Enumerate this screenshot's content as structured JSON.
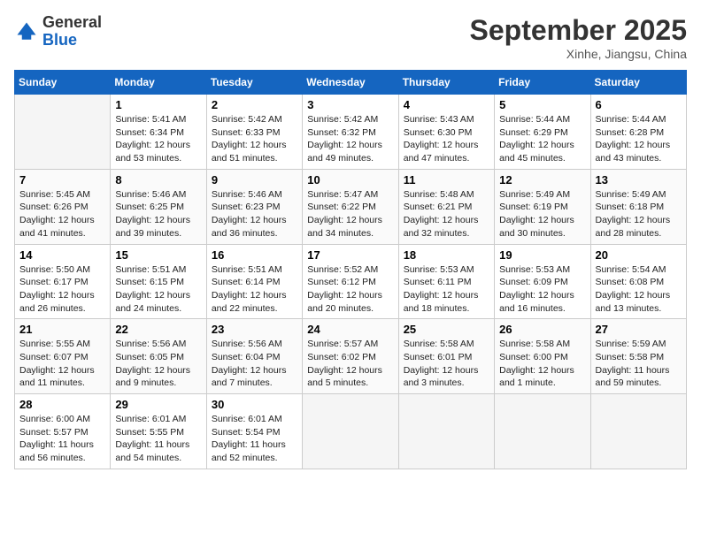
{
  "header": {
    "logo_line1": "General",
    "logo_line2": "Blue",
    "month_title": "September 2025",
    "location": "Xinhe, Jiangsu, China"
  },
  "days_of_week": [
    "Sunday",
    "Monday",
    "Tuesday",
    "Wednesday",
    "Thursday",
    "Friday",
    "Saturday"
  ],
  "weeks": [
    [
      {
        "day": "",
        "info": ""
      },
      {
        "day": "1",
        "info": "Sunrise: 5:41 AM\nSunset: 6:34 PM\nDaylight: 12 hours\nand 53 minutes."
      },
      {
        "day": "2",
        "info": "Sunrise: 5:42 AM\nSunset: 6:33 PM\nDaylight: 12 hours\nand 51 minutes."
      },
      {
        "day": "3",
        "info": "Sunrise: 5:42 AM\nSunset: 6:32 PM\nDaylight: 12 hours\nand 49 minutes."
      },
      {
        "day": "4",
        "info": "Sunrise: 5:43 AM\nSunset: 6:30 PM\nDaylight: 12 hours\nand 47 minutes."
      },
      {
        "day": "5",
        "info": "Sunrise: 5:44 AM\nSunset: 6:29 PM\nDaylight: 12 hours\nand 45 minutes."
      },
      {
        "day": "6",
        "info": "Sunrise: 5:44 AM\nSunset: 6:28 PM\nDaylight: 12 hours\nand 43 minutes."
      }
    ],
    [
      {
        "day": "7",
        "info": "Sunrise: 5:45 AM\nSunset: 6:26 PM\nDaylight: 12 hours\nand 41 minutes."
      },
      {
        "day": "8",
        "info": "Sunrise: 5:46 AM\nSunset: 6:25 PM\nDaylight: 12 hours\nand 39 minutes."
      },
      {
        "day": "9",
        "info": "Sunrise: 5:46 AM\nSunset: 6:23 PM\nDaylight: 12 hours\nand 36 minutes."
      },
      {
        "day": "10",
        "info": "Sunrise: 5:47 AM\nSunset: 6:22 PM\nDaylight: 12 hours\nand 34 minutes."
      },
      {
        "day": "11",
        "info": "Sunrise: 5:48 AM\nSunset: 6:21 PM\nDaylight: 12 hours\nand 32 minutes."
      },
      {
        "day": "12",
        "info": "Sunrise: 5:49 AM\nSunset: 6:19 PM\nDaylight: 12 hours\nand 30 minutes."
      },
      {
        "day": "13",
        "info": "Sunrise: 5:49 AM\nSunset: 6:18 PM\nDaylight: 12 hours\nand 28 minutes."
      }
    ],
    [
      {
        "day": "14",
        "info": "Sunrise: 5:50 AM\nSunset: 6:17 PM\nDaylight: 12 hours\nand 26 minutes."
      },
      {
        "day": "15",
        "info": "Sunrise: 5:51 AM\nSunset: 6:15 PM\nDaylight: 12 hours\nand 24 minutes."
      },
      {
        "day": "16",
        "info": "Sunrise: 5:51 AM\nSunset: 6:14 PM\nDaylight: 12 hours\nand 22 minutes."
      },
      {
        "day": "17",
        "info": "Sunrise: 5:52 AM\nSunset: 6:12 PM\nDaylight: 12 hours\nand 20 minutes."
      },
      {
        "day": "18",
        "info": "Sunrise: 5:53 AM\nSunset: 6:11 PM\nDaylight: 12 hours\nand 18 minutes."
      },
      {
        "day": "19",
        "info": "Sunrise: 5:53 AM\nSunset: 6:09 PM\nDaylight: 12 hours\nand 16 minutes."
      },
      {
        "day": "20",
        "info": "Sunrise: 5:54 AM\nSunset: 6:08 PM\nDaylight: 12 hours\nand 13 minutes."
      }
    ],
    [
      {
        "day": "21",
        "info": "Sunrise: 5:55 AM\nSunset: 6:07 PM\nDaylight: 12 hours\nand 11 minutes."
      },
      {
        "day": "22",
        "info": "Sunrise: 5:56 AM\nSunset: 6:05 PM\nDaylight: 12 hours\nand 9 minutes."
      },
      {
        "day": "23",
        "info": "Sunrise: 5:56 AM\nSunset: 6:04 PM\nDaylight: 12 hours\nand 7 minutes."
      },
      {
        "day": "24",
        "info": "Sunrise: 5:57 AM\nSunset: 6:02 PM\nDaylight: 12 hours\nand 5 minutes."
      },
      {
        "day": "25",
        "info": "Sunrise: 5:58 AM\nSunset: 6:01 PM\nDaylight: 12 hours\nand 3 minutes."
      },
      {
        "day": "26",
        "info": "Sunrise: 5:58 AM\nSunset: 6:00 PM\nDaylight: 12 hours\nand 1 minute."
      },
      {
        "day": "27",
        "info": "Sunrise: 5:59 AM\nSunset: 5:58 PM\nDaylight: 11 hours\nand 59 minutes."
      }
    ],
    [
      {
        "day": "28",
        "info": "Sunrise: 6:00 AM\nSunset: 5:57 PM\nDaylight: 11 hours\nand 56 minutes."
      },
      {
        "day": "29",
        "info": "Sunrise: 6:01 AM\nSunset: 5:55 PM\nDaylight: 11 hours\nand 54 minutes."
      },
      {
        "day": "30",
        "info": "Sunrise: 6:01 AM\nSunset: 5:54 PM\nDaylight: 11 hours\nand 52 minutes."
      },
      {
        "day": "",
        "info": ""
      },
      {
        "day": "",
        "info": ""
      },
      {
        "day": "",
        "info": ""
      },
      {
        "day": "",
        "info": ""
      }
    ]
  ]
}
